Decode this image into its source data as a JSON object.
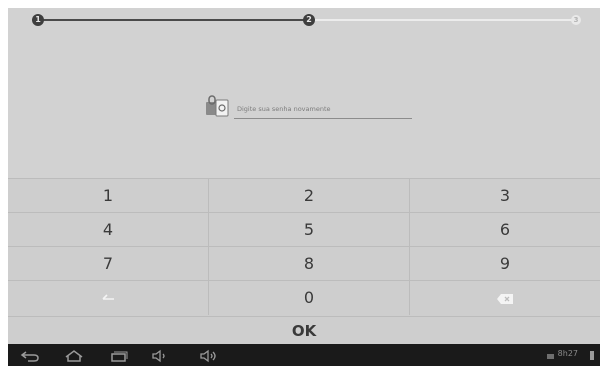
{
  "progress": {
    "steps": [
      "1",
      "2",
      "3"
    ],
    "current_step": 2
  },
  "password": {
    "placeholder": "Digite sua senha novamente",
    "icon": "lock-icon"
  },
  "keypad": {
    "rows": [
      [
        "1",
        "2",
        "3"
      ],
      [
        "4",
        "5",
        "6"
      ],
      [
        "7",
        "8",
        "9"
      ]
    ],
    "bottom_row": {
      "back_icon": "back-arrow-icon",
      "zero": "0",
      "delete_icon": "backspace-icon"
    },
    "ok_label": "OK"
  },
  "system_bar": {
    "icons": [
      "back-icon",
      "home-icon",
      "recent-apps-icon",
      "volume-down-icon",
      "volume-up-icon"
    ],
    "time": "8h27",
    "status_icons": [
      "screenshot-icon",
      "battery-icon"
    ]
  },
  "colors": {
    "screen_bg": "#d2d2d2",
    "progress_done": "#3e3e3e",
    "progress_todo": "#ececec",
    "system_bar": "#1a1a1a"
  }
}
